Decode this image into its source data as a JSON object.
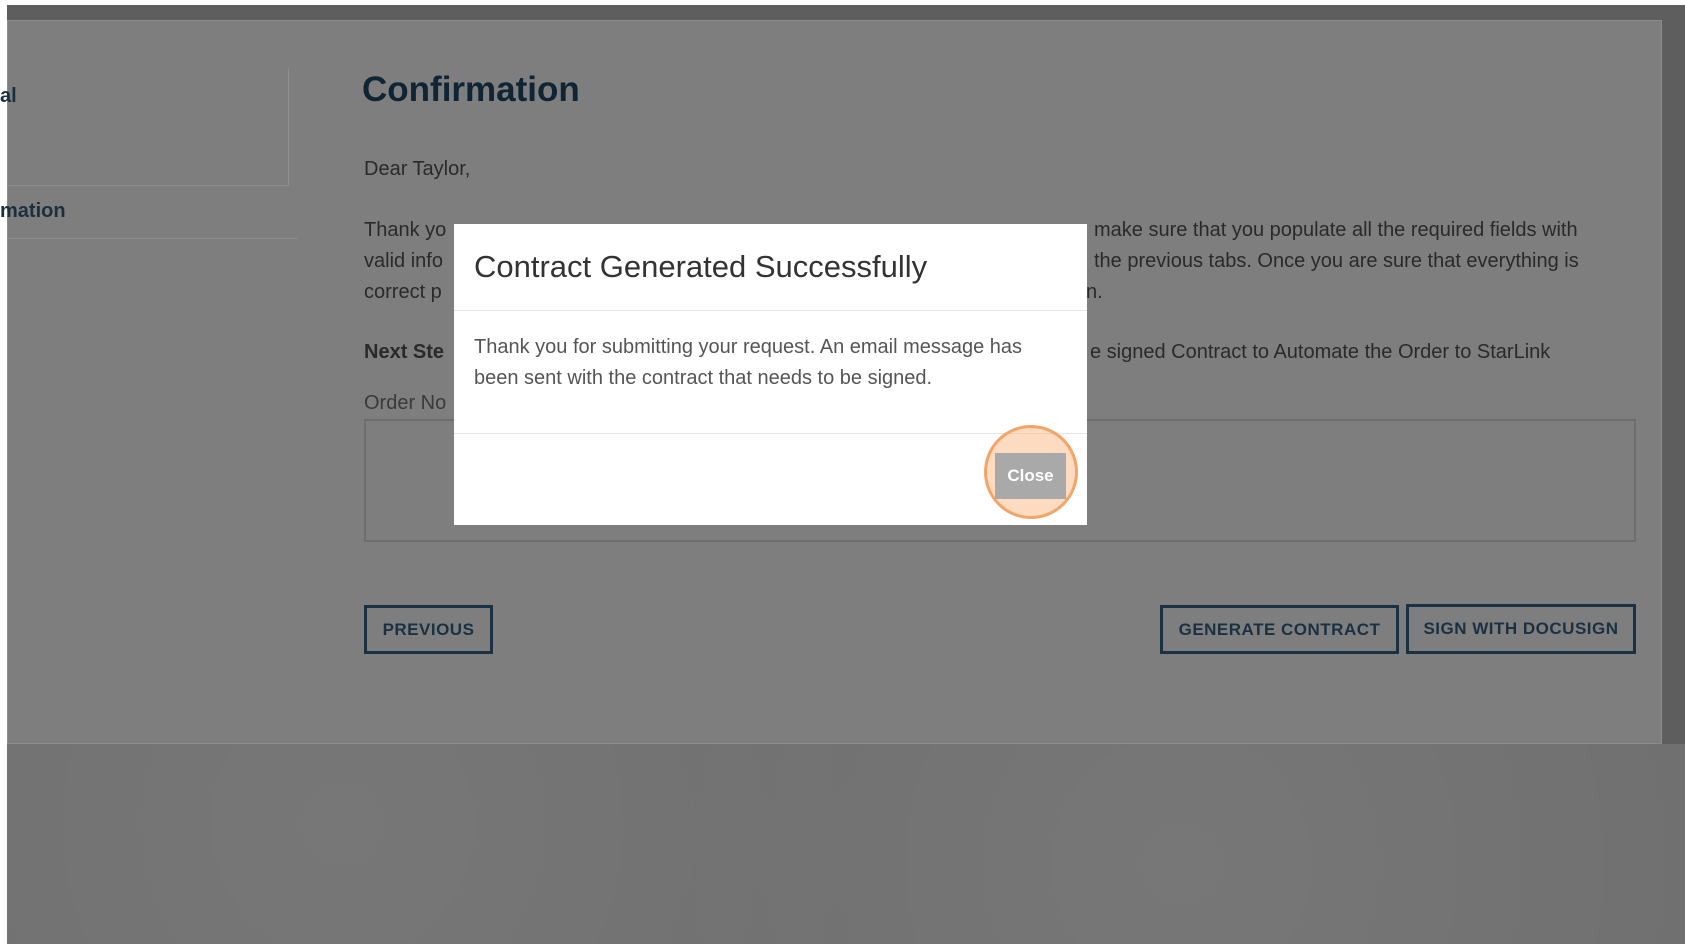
{
  "sidebar": {
    "items": [
      {
        "label": "al"
      },
      {
        "label": "mation"
      }
    ]
  },
  "main": {
    "title": "Confirmation",
    "greeting": "Dear Taylor,",
    "paragraph_start": "Thank yo",
    "paragraph_end": "make sure that you populate all the required fields with valid info the previous tabs. Once you are sure that everything is correct p",
    "paragraph_line1_left": "Thank yo",
    "paragraph_line1_right": "make sure that you populate all the required fields with",
    "paragraph_line2_left": "valid info",
    "paragraph_line2_right": "the previous tabs. Once you are sure that everything is",
    "paragraph_line3_left": "correct p",
    "paragraph_line3_right": "n.",
    "next_step_label": "Next Ste",
    "next_step_text": "e signed Contract to Automate the Order to StarLink",
    "order_notes_label": "Order No"
  },
  "buttons": {
    "previous": "PREVIOUS",
    "generate_contract": "GENERATE CONTRACT",
    "sign_with_docusign": "SIGN WITH DOCUSIGN"
  },
  "modal": {
    "title": "Contract Generated Successfully",
    "body": "Thank you for submitting your request. An email message has been sent with the contract that needs to be signed.",
    "close_label": "Close"
  },
  "colors": {
    "overlay": "#7e7e7e",
    "heading": "#0f2434",
    "button_border": "#1b3142",
    "highlight": "#f3a468"
  }
}
